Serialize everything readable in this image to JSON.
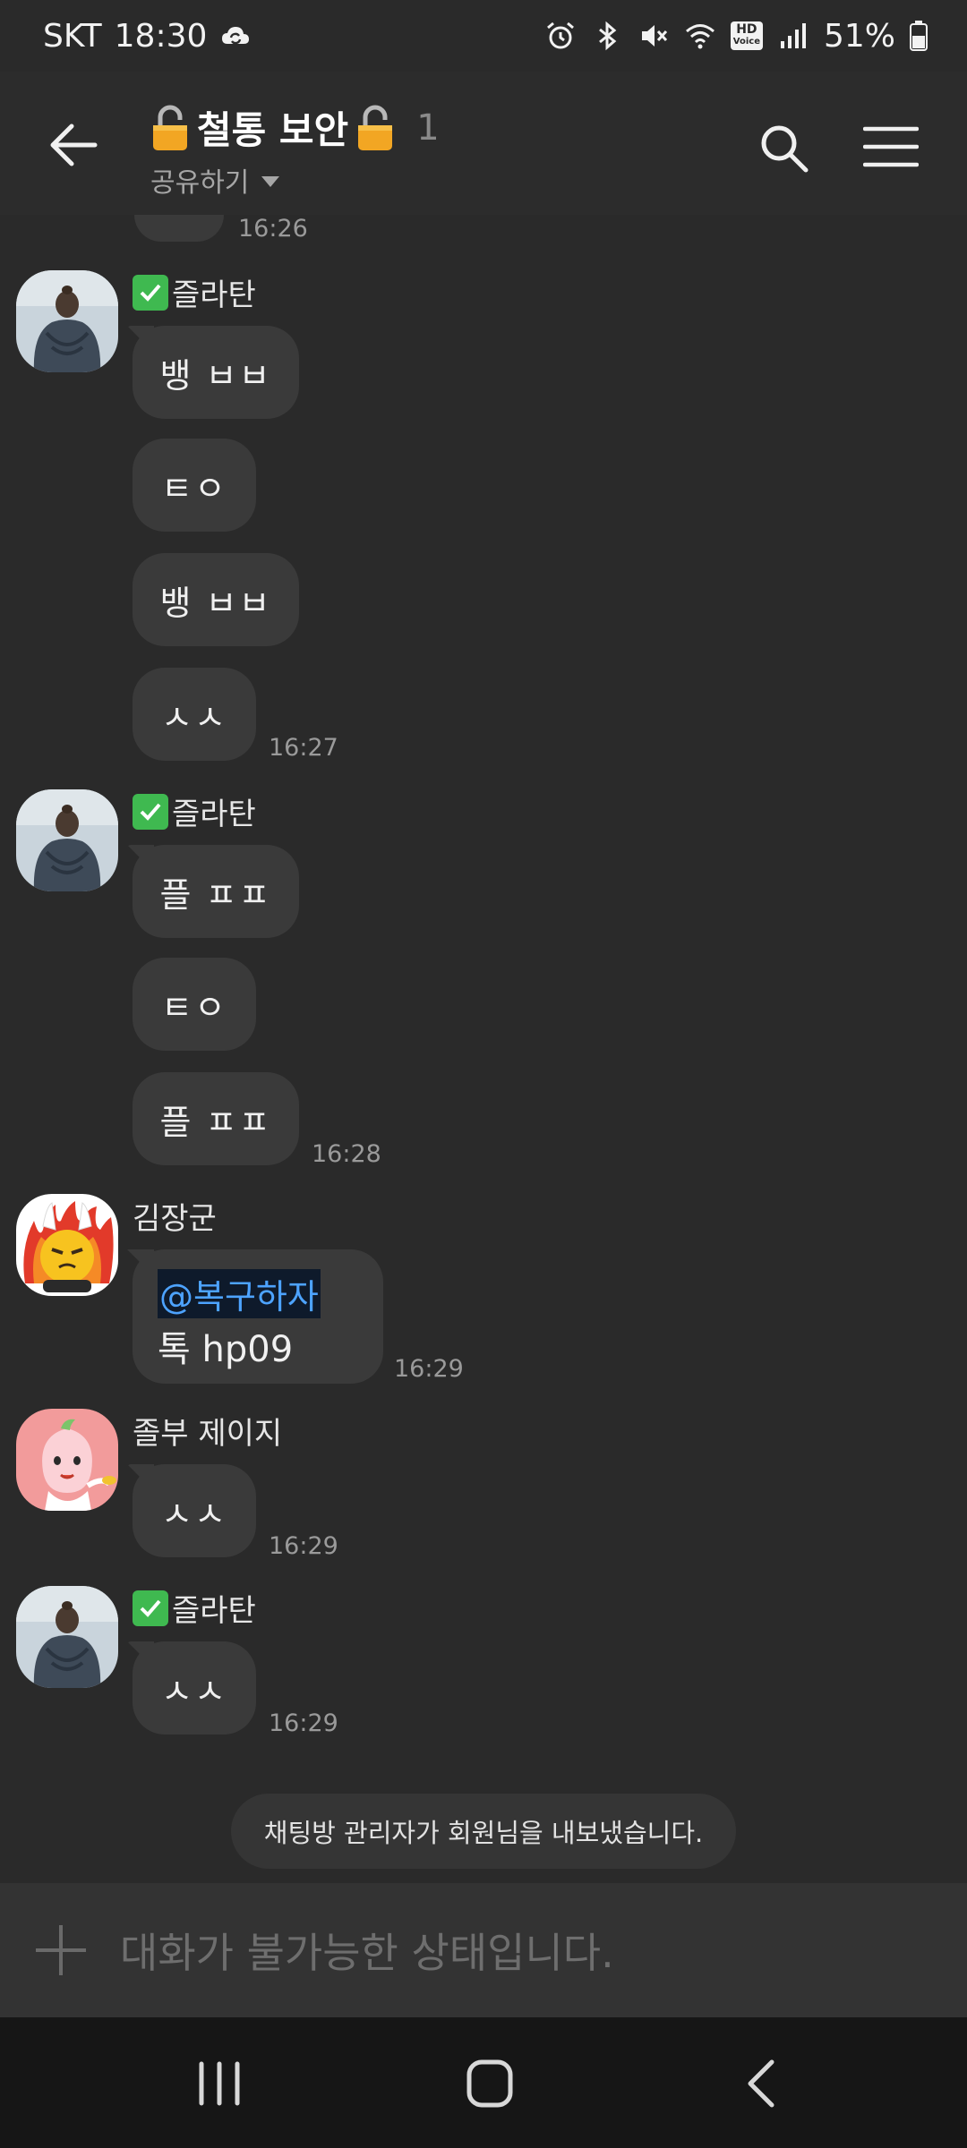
{
  "status_bar": {
    "carrier": "SKT",
    "time": "18:30",
    "battery": "51%",
    "hd_voice_top": "HD",
    "hd_voice_bottom": "Voice"
  },
  "header": {
    "title": "철통 보안",
    "member_count": "1",
    "share_label": "공유하기"
  },
  "messages": {
    "previous_time": "16:26",
    "group1": {
      "sender": "즐라탄",
      "bubbles": [
        "뱅 ㅂㅂ",
        "ㅌㅇ",
        "뱅 ㅂㅂ",
        "ㅅㅅ"
      ],
      "time": "16:27"
    },
    "group2": {
      "sender": "즐라탄",
      "bubbles": [
        "플 ㅍㅍ",
        "ㅌㅇ",
        "플 ㅍㅍ"
      ],
      "time": "16:28"
    },
    "group3": {
      "sender": "김장군",
      "mention": "@복구하자",
      "text": "톡 hp09",
      "time": "16:29"
    },
    "group4": {
      "sender": "졸부 제이지",
      "bubble": "ㅅㅅ",
      "time": "16:29"
    },
    "group5": {
      "sender": "즐라탄",
      "bubble": "ㅅㅅ",
      "time": "16:29"
    }
  },
  "system_notice": "채팅방 관리자가 회원님을 내보냈습니다.",
  "input_bar": {
    "disabled_message": "대화가 불가능한 상태입니다."
  },
  "colors": {
    "background": "#2a2a2a",
    "bubble": "#3a3a3a",
    "mention_blue": "#4da3ff",
    "check_green": "#3fb950"
  }
}
